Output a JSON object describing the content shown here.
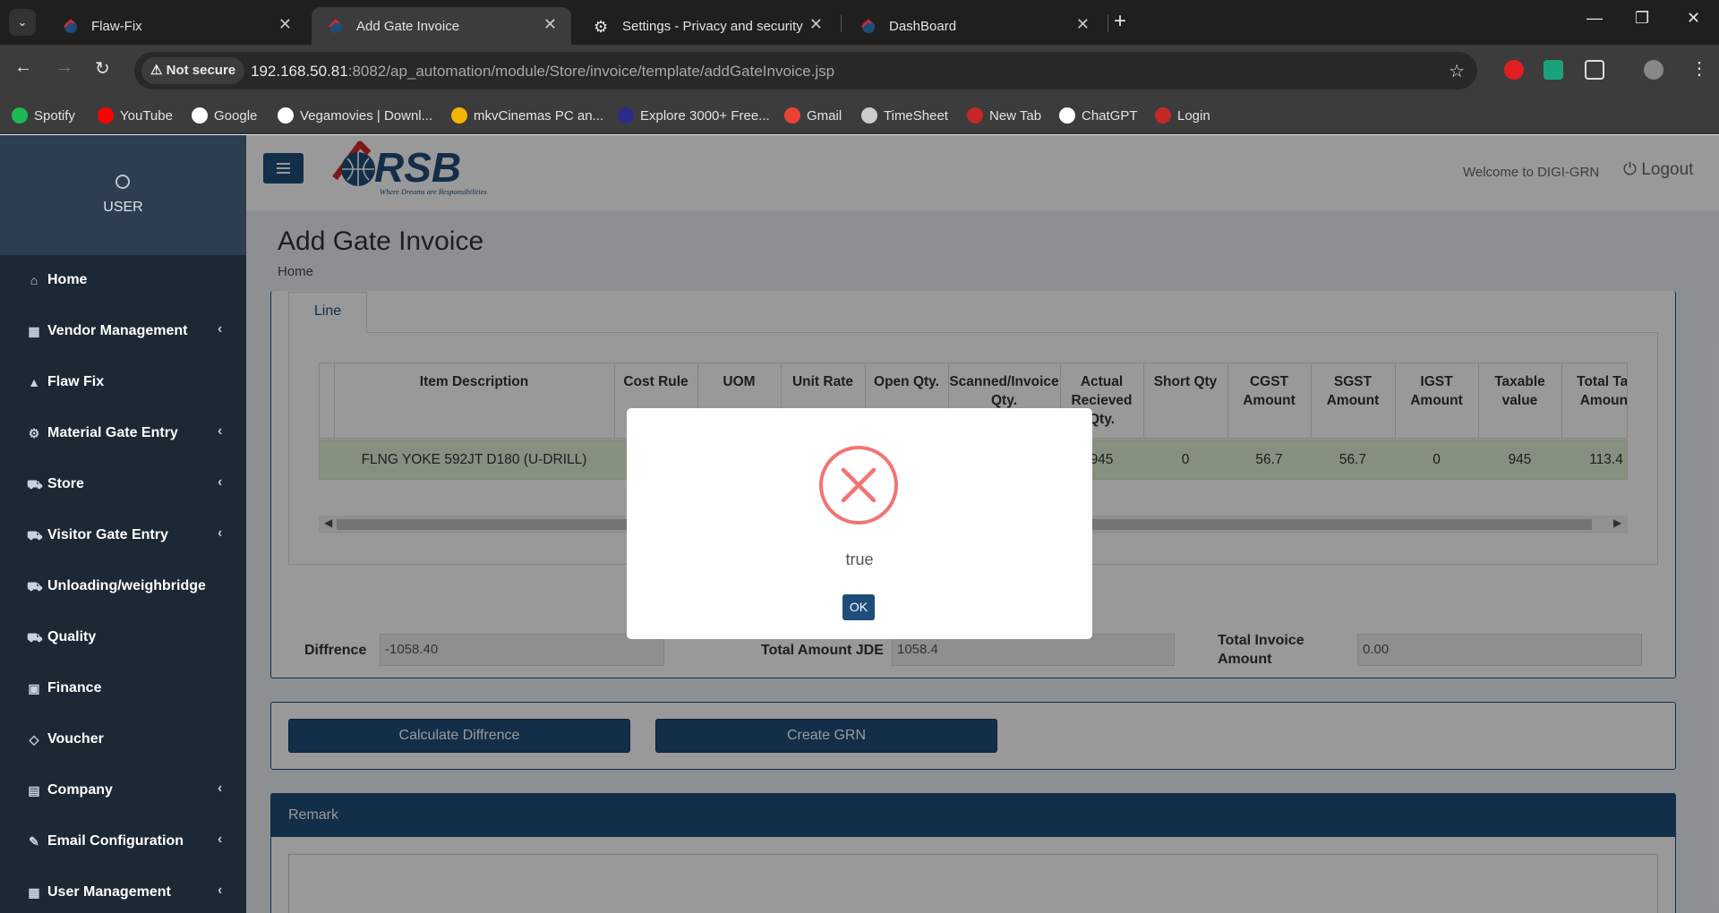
{
  "browser": {
    "tabs": [
      {
        "title": "Flaw-Fix"
      },
      {
        "title": "Add Gate Invoice"
      },
      {
        "title": "Settings - Privacy and security"
      },
      {
        "title": "DashBoard"
      }
    ],
    "security_chip": "Not secure",
    "url_host": "192.168.50.81",
    "url_path": ":8082/ap_automation/module/Store/invoice/template/addGateInvoice.jsp",
    "bookmarks": [
      {
        "label": "Spotify",
        "color": "#1db954"
      },
      {
        "label": "YouTube",
        "color": "#ff0000"
      },
      {
        "label": "Google",
        "color": "#ffffff"
      },
      {
        "label": "Vegamovies | Downl...",
        "color": "#ffffff"
      },
      {
        "label": "mkvCinemas PC an...",
        "color": "#f5b400"
      },
      {
        "label": "Explore 3000+ Free...",
        "color": "#2b2b8c"
      },
      {
        "label": "Gmail",
        "color": "#ea4335"
      },
      {
        "label": "TimeSheet",
        "color": "#cccccc"
      },
      {
        "label": "New Tab",
        "color": "#c62828"
      },
      {
        "label": "ChatGPT",
        "color": "#ffffff"
      },
      {
        "label": "Login",
        "color": "#c62828"
      }
    ]
  },
  "sidebar": {
    "user_label": "USER",
    "items": [
      {
        "label": "Home",
        "icon": "home-icon",
        "glyph": "⌂",
        "has_caret": false
      },
      {
        "label": "Vendor Management",
        "icon": "grid-icon",
        "glyph": "▦",
        "has_caret": true
      },
      {
        "label": "Flaw Fix",
        "icon": "warning-icon",
        "glyph": "▲",
        "has_caret": false
      },
      {
        "label": "Material Gate Entry",
        "icon": "gears-icon",
        "glyph": "⚙",
        "has_caret": true
      },
      {
        "label": "Store",
        "icon": "cart-icon",
        "glyph": "⛟",
        "has_caret": true
      },
      {
        "label": "Visitor Gate Entry",
        "icon": "truck-icon",
        "glyph": "⛟",
        "has_caret": true
      },
      {
        "label": "Unloading/weighbridge",
        "icon": "truck-icon",
        "glyph": "⛟",
        "has_caret": false
      },
      {
        "label": "Quality",
        "icon": "truck-icon",
        "glyph": "⛟",
        "has_caret": false
      },
      {
        "label": "Finance",
        "icon": "money-icon",
        "glyph": "▣",
        "has_caret": false
      },
      {
        "label": "Voucher",
        "icon": "diamond-icon",
        "glyph": "◇",
        "has_caret": false
      },
      {
        "label": "Company",
        "icon": "book-icon",
        "glyph": "▤",
        "has_caret": true
      },
      {
        "label": "Email Configuration",
        "icon": "edit-icon",
        "glyph": "✎",
        "has_caret": true
      },
      {
        "label": "User Management",
        "icon": "grid-icon",
        "glyph": "▦",
        "has_caret": true
      }
    ]
  },
  "header": {
    "logo_text": "RSB",
    "logo_tagline": "Where Dreams are Responsibilities",
    "welcome": "Welcome to DIGI-GRN",
    "logout": "Logout"
  },
  "page": {
    "title": "Add Gate Invoice",
    "breadcrumb": "Home",
    "line_tab": "Line"
  },
  "table": {
    "headers": [
      "Item Description",
      "Cost Rule",
      "UOM",
      "Unit Rate",
      "Open Qty.",
      "Scanned/Invoice Qty.",
      "Actual Recieved Qty.",
      "Short Qty",
      "CGST Amount",
      "SGST Amount",
      "IGST Amount",
      "Taxable value",
      "Total Tax Amount"
    ],
    "header_lines": [
      [
        "Item Description"
      ],
      [
        "Cost Rule"
      ],
      [
        "UOM"
      ],
      [
        "Unit Rate"
      ],
      [
        "Open Qty."
      ],
      [
        "Scanned/Invoice",
        "Qty."
      ],
      [
        "Actual",
        "Recieved",
        "Qty."
      ],
      [
        "Short Qty"
      ],
      [
        "CGST",
        "Amount"
      ],
      [
        "SGST",
        "Amount"
      ],
      [
        "IGST",
        "Amount"
      ],
      [
        "Taxable",
        "value"
      ],
      [
        "Total Tax",
        "Amount"
      ]
    ],
    "row": {
      "item_description": "FLNG YOKE 592JT D180 (U-DRILL)",
      "actual_received_qty": "945",
      "short_qty": "0",
      "cgst": "56.7",
      "sgst": "56.7",
      "igst": "0",
      "taxable_value": "945",
      "total_tax": "113.4"
    }
  },
  "totals": {
    "difference_label": "Diffrence",
    "difference_value": "-1058.40",
    "jde_label": "Total Amount JDE",
    "jde_value": "1058.4",
    "invoice_label_1": "Total Invoice",
    "invoice_label_2": "Amount",
    "invoice_value": "0.00"
  },
  "actions": {
    "calculate": "Calculate Diffrence",
    "create_grn": "Create GRN"
  },
  "remark": {
    "title": "Remark"
  },
  "modal": {
    "icon": "error-x-icon",
    "message": "true",
    "ok_label": "OK"
  },
  "colors": {
    "brand": "#1e4d7b",
    "sidebar_bg": "#1c2834",
    "row_highlight": "#dff0d8",
    "error": "#f27474"
  }
}
